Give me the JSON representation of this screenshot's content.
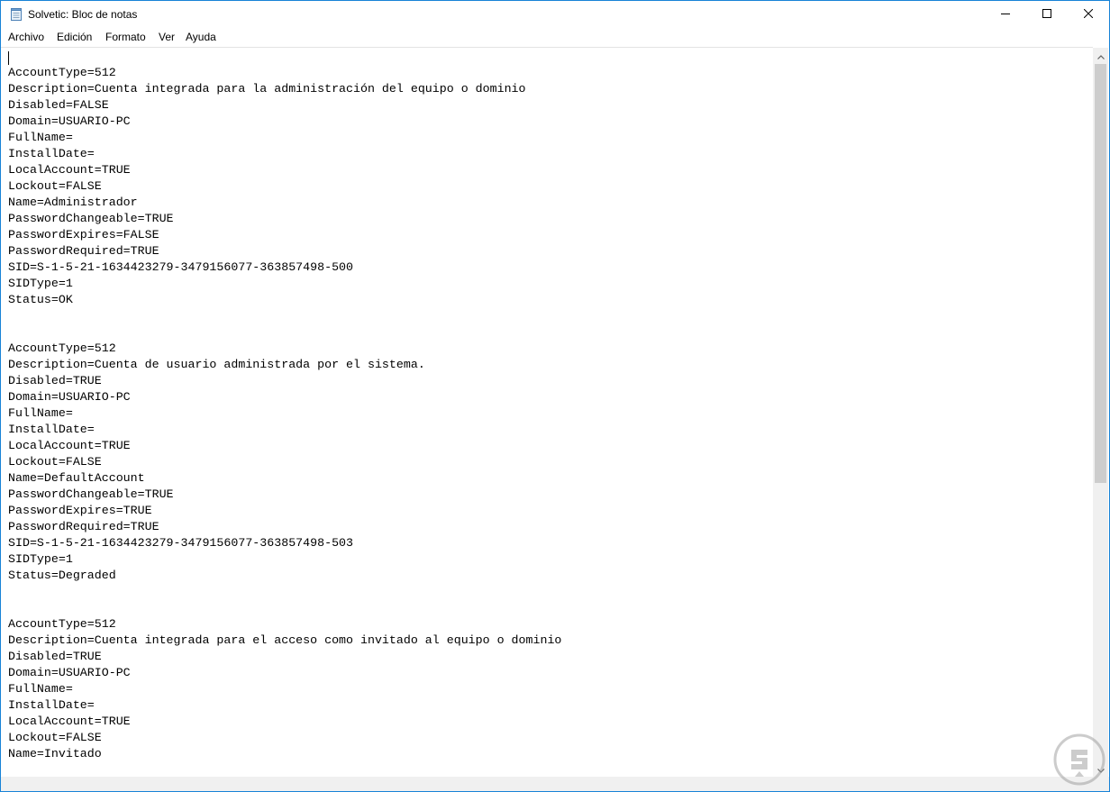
{
  "window": {
    "title": "Solvetic: Bloc de notas",
    "app_icon": "notepad-icon",
    "controls": {
      "minimize_icon": "minimize-icon",
      "maximize_icon": "maximize-icon",
      "close_icon": "close-icon"
    }
  },
  "menu": {
    "items": [
      {
        "label": "Archivo"
      },
      {
        "label": "Edición"
      },
      {
        "label": "Formato"
      },
      {
        "label": "Ver"
      },
      {
        "label": "Ayuda"
      }
    ]
  },
  "editor": {
    "lines": [
      "AccountType=512",
      "Description=Cuenta integrada para la administración del equipo o dominio",
      "Disabled=FALSE",
      "Domain=USUARIO-PC",
      "FullName=",
      "InstallDate=",
      "LocalAccount=TRUE",
      "Lockout=FALSE",
      "Name=Administrador",
      "PasswordChangeable=TRUE",
      "PasswordExpires=FALSE",
      "PasswordRequired=TRUE",
      "SID=S-1-5-21-1634423279-3479156077-363857498-500",
      "SIDType=1",
      "Status=OK",
      "",
      "",
      "AccountType=512",
      "Description=Cuenta de usuario administrada por el sistema.",
      "Disabled=TRUE",
      "Domain=USUARIO-PC",
      "FullName=",
      "InstallDate=",
      "LocalAccount=TRUE",
      "Lockout=FALSE",
      "Name=DefaultAccount",
      "PasswordChangeable=TRUE",
      "PasswordExpires=TRUE",
      "PasswordRequired=TRUE",
      "SID=S-1-5-21-1634423279-3479156077-363857498-503",
      "SIDType=1",
      "Status=Degraded",
      "",
      "",
      "AccountType=512",
      "Description=Cuenta integrada para el acceso como invitado al equipo o dominio",
      "Disabled=TRUE",
      "Domain=USUARIO-PC",
      "FullName=",
      "InstallDate=",
      "LocalAccount=TRUE",
      "Lockout=FALSE",
      "Name=Invitado"
    ]
  },
  "scrollbar": {
    "up_icon": "scroll-up-icon",
    "down_icon": "scroll-down-icon",
    "thumb_fraction": 0.6
  },
  "watermark": {
    "icon": "solvetic-logo-icon"
  },
  "colors": {
    "window_border": "#1883d7",
    "scroll_track": "#f0f0f0",
    "scroll_thumb": "#cdcdcd"
  }
}
